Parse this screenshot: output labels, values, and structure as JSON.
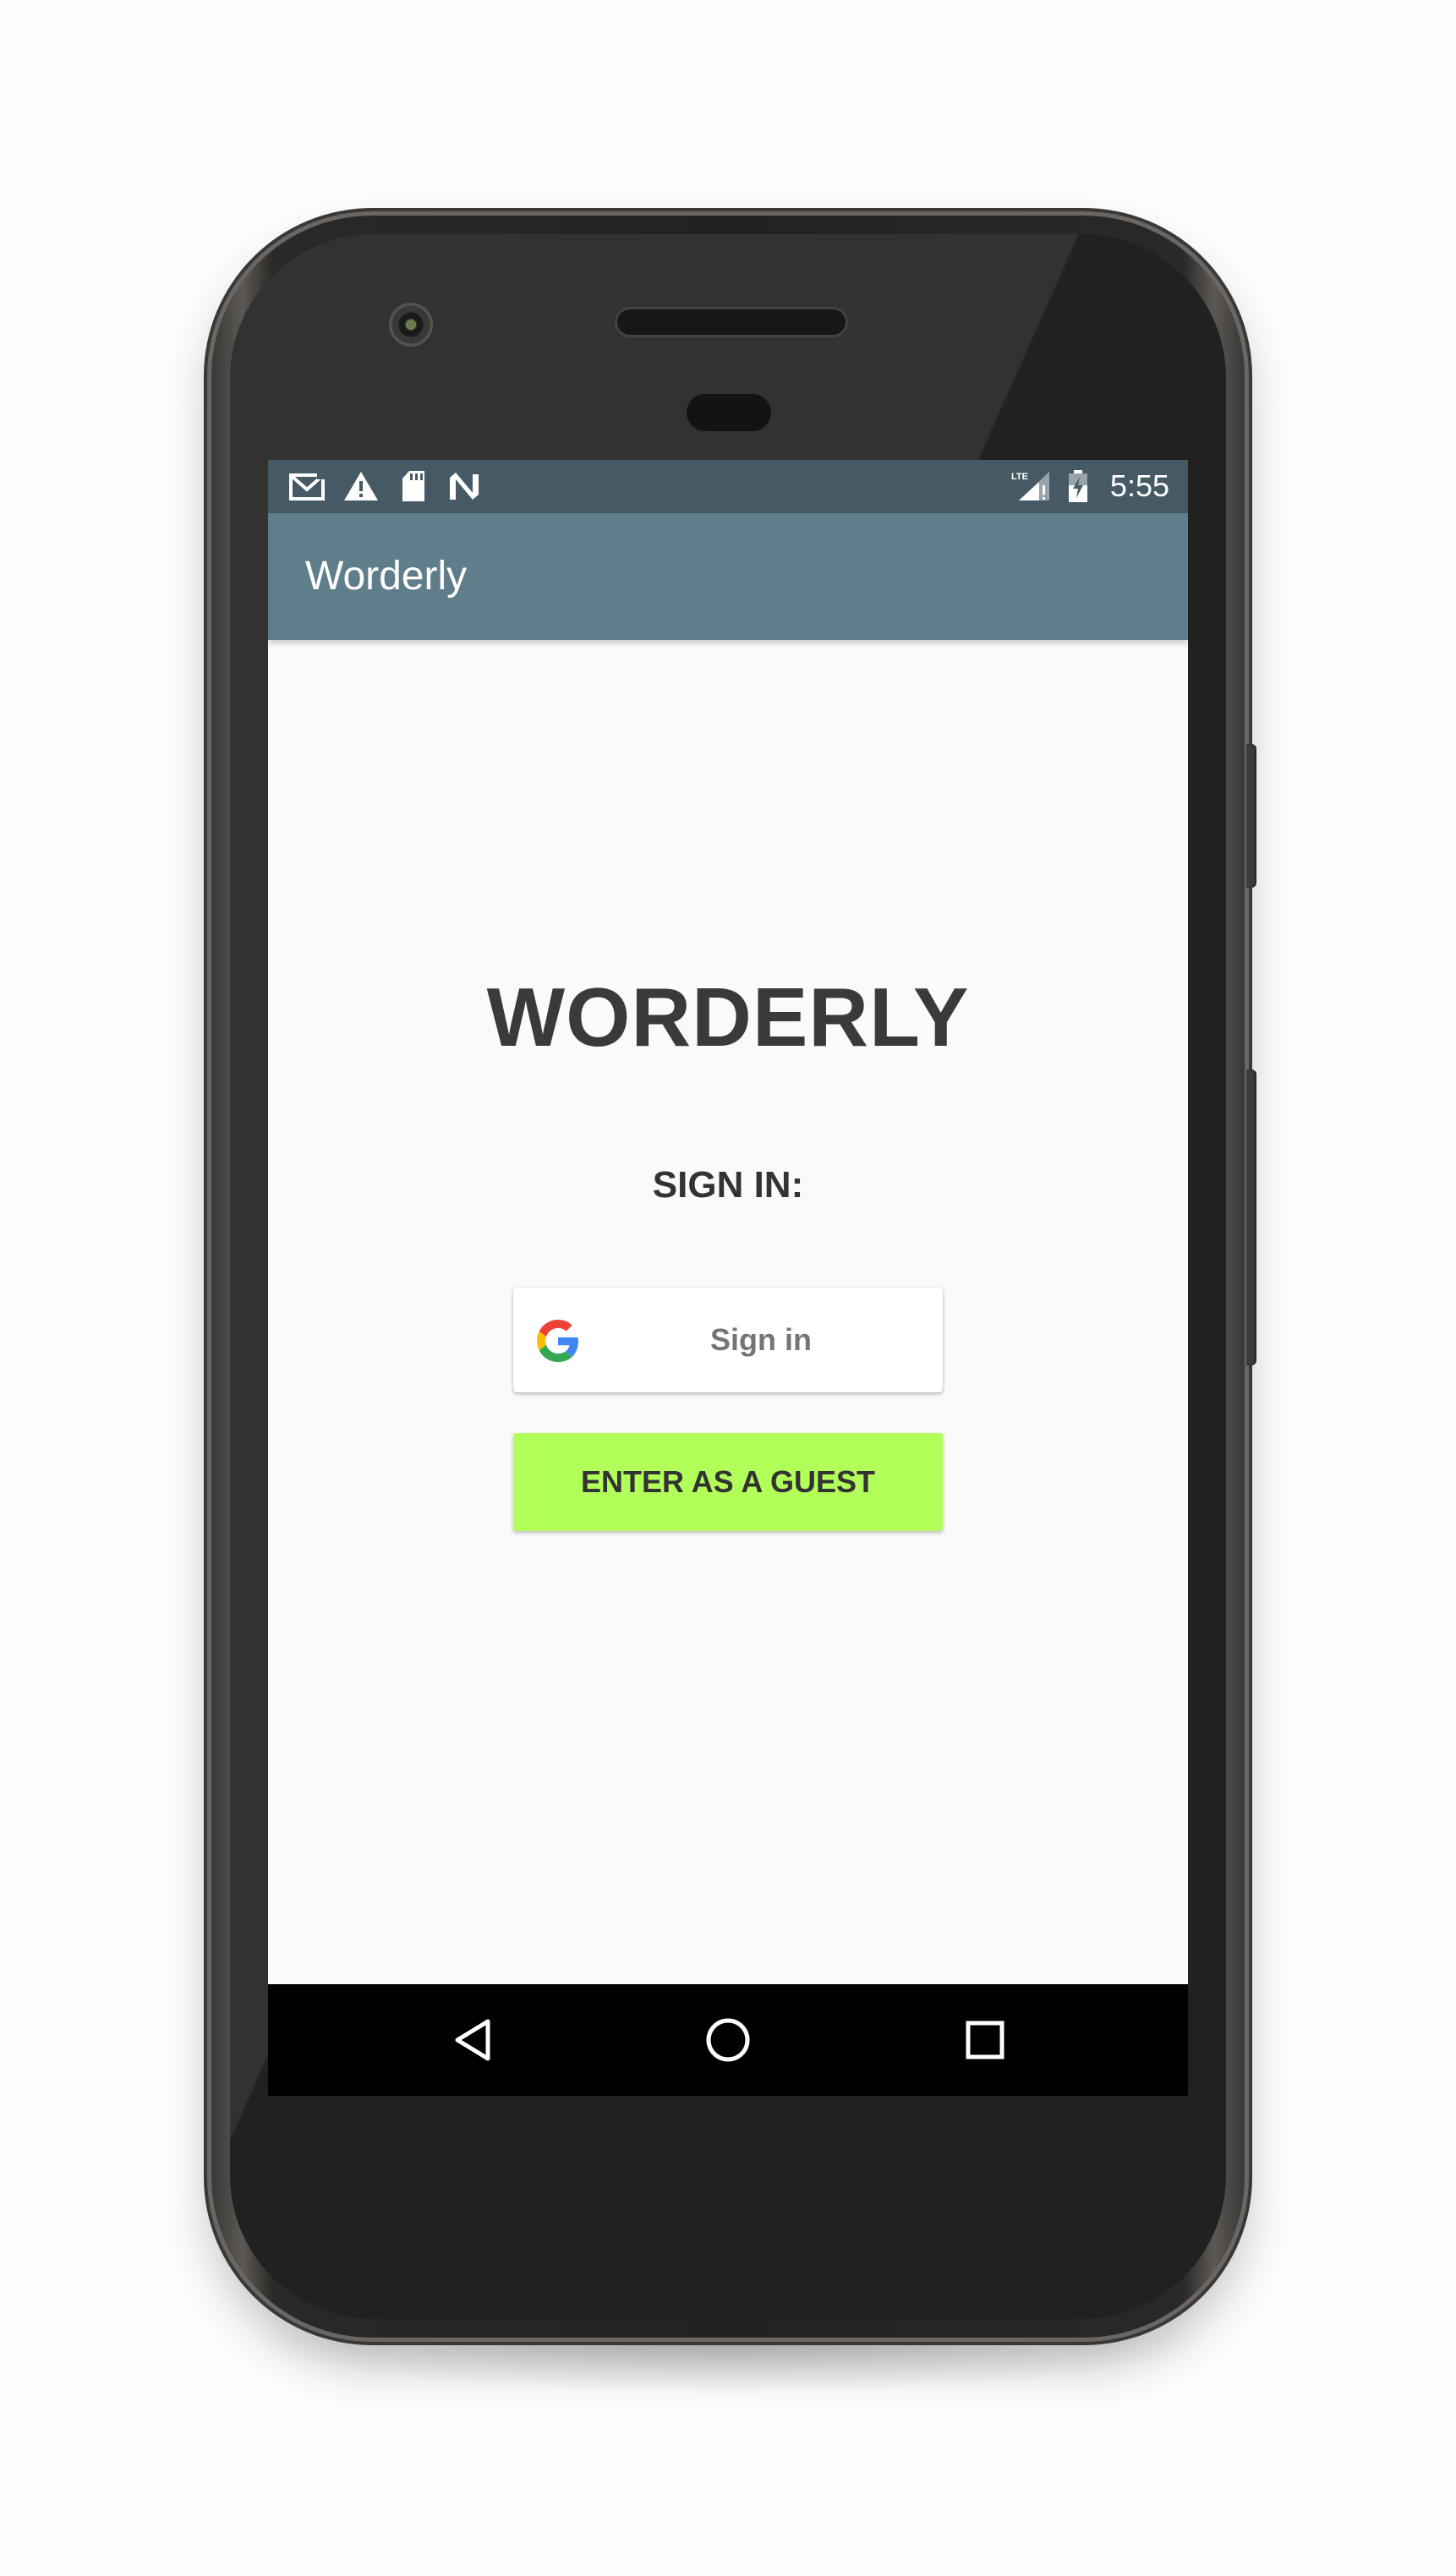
{
  "status_bar": {
    "time": "5:55",
    "left_icons": [
      "gmail-icon",
      "warning-icon",
      "sd-card-icon",
      "n-icon"
    ],
    "right_icons": [
      "lte-signal-icon",
      "battery-charging-icon"
    ],
    "network_label": "LTE",
    "background_color": "#455a64"
  },
  "app_bar": {
    "title": "Worderly",
    "background_color": "#607d8b"
  },
  "main": {
    "brand_title": "WORDERLY",
    "sign_in_label": "SIGN IN:",
    "google_button": {
      "label": "Sign in",
      "icon": "google-icon"
    },
    "guest_button": {
      "label": "ENTER AS A GUEST",
      "background_color": "#b2ff59"
    }
  },
  "nav_bar": {
    "buttons": [
      "back-icon",
      "home-icon",
      "recents-icon"
    ]
  }
}
